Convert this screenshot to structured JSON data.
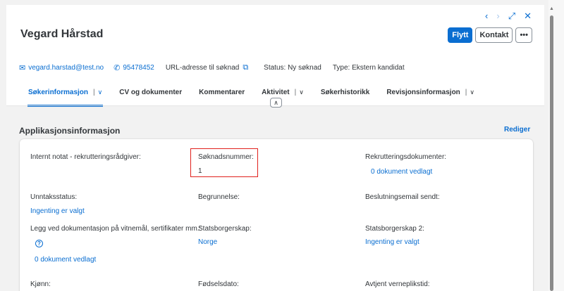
{
  "header": {
    "title": "Vegard Hårstad",
    "nav": {
      "prev": "‹",
      "next": "›",
      "expand": "⤢",
      "close": "✕"
    },
    "actions": {
      "move": "Flytt",
      "contact": "Kontakt",
      "more": "•••"
    }
  },
  "meta": {
    "email": "vegard.harstad@test.no",
    "phone": "95478452",
    "url_label": "URL-adresse til søknad",
    "status": "Status: Ny søknad",
    "type": "Type: Ekstern kandidat"
  },
  "tabs": [
    {
      "label": "Søkerinformasjon",
      "active": true,
      "dropdown": true
    },
    {
      "label": "CV og dokumenter"
    },
    {
      "label": "Kommentarer"
    },
    {
      "label": "Aktivitet",
      "dropdown": true
    },
    {
      "label": "Søkerhistorikk"
    },
    {
      "label": "Revisjonsinformasjon",
      "dropdown": true
    }
  ],
  "section": {
    "title": "Applikasjonsinformasjon",
    "edit": "Rediger"
  },
  "fields": {
    "internal_note": {
      "label": "Internt notat - rekrutteringsrådgiver:"
    },
    "application_number": {
      "label": "Søknadsnummer:",
      "value": "1"
    },
    "recruitment_docs": {
      "label": "Rekrutteringsdokumenter:",
      "value": "0 dokument vedlagt"
    },
    "exception_status": {
      "label": "Unntaksstatus:",
      "value": "Ingenting er valgt"
    },
    "justification": {
      "label": "Begrunnelse:"
    },
    "decision_email": {
      "label": "Beslutningsemail sendt:"
    },
    "attach_docs": {
      "label": "Legg ved dokumentasjon på vitnemål, sertifikater mm.:",
      "value": "0 dokument vedlagt"
    },
    "citizenship": {
      "label": "Statsborgerskap:",
      "value": "Norge"
    },
    "citizenship2": {
      "label": "Statsborgerskap 2:",
      "value": "Ingenting er valgt"
    },
    "gender": {
      "label": "Kjønn:"
    },
    "birthdate": {
      "label": "Fødselsdato:"
    },
    "military_service": {
      "label": "Avtjent verneplikstid:"
    }
  },
  "colors": {
    "accent": "#0a6ed1",
    "highlight": "#e0201c"
  }
}
